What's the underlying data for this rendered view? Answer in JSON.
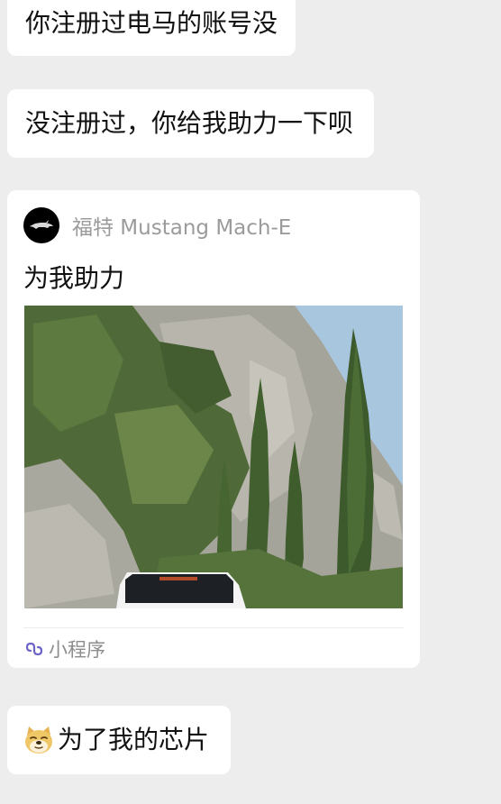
{
  "messages": [
    {
      "text": "你注册过电马的账号没"
    },
    {
      "text": "没注册过，你给我助力一下呗"
    }
  ],
  "mini_program_card": {
    "app_name": "福特 Mustang Mach-E",
    "title": "为我助力",
    "footer_label": "小程序",
    "avatar_icon": "mustang-logo-icon",
    "footer_icon": "mini-program-link-icon"
  },
  "last_message": {
    "emoji_icon": "doge-face-icon",
    "text": "为了我的芯片"
  }
}
